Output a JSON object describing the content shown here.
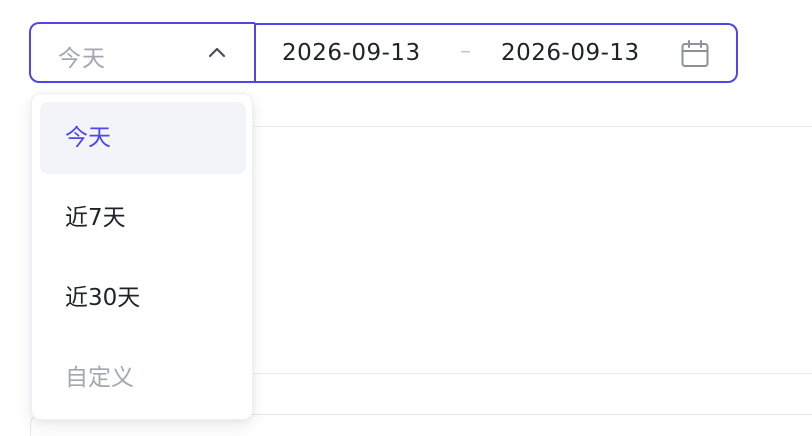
{
  "range_select": {
    "value": "今天",
    "expanded": true,
    "icon": "chevron-up-icon"
  },
  "date_range": {
    "start": "2026-09-13",
    "separator": "–",
    "end": "2026-09-13",
    "icon": "calendar-icon"
  },
  "dropdown": {
    "options": [
      {
        "label": "今天",
        "selected": true
      },
      {
        "label": "近7天",
        "selected": false
      },
      {
        "label": "近30天",
        "selected": false
      },
      {
        "label": "自定义",
        "selected": false,
        "disabled": true
      }
    ]
  },
  "colors": {
    "accent": "#4f46e5",
    "text": "#1f2329",
    "muted": "#a3a7b1",
    "selected_bg": "#f3f4f9"
  }
}
